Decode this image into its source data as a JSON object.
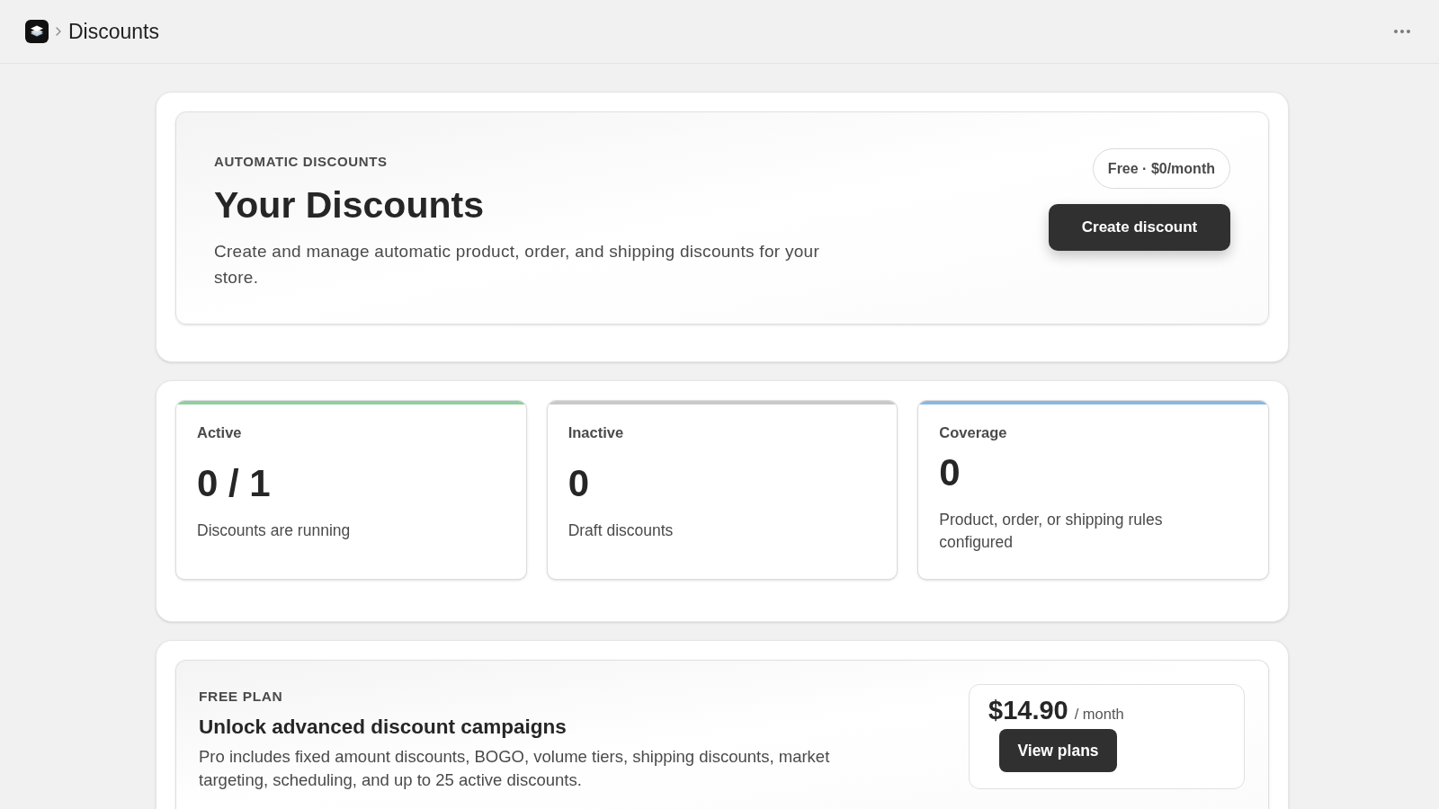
{
  "top_bar": {
    "title": "Discounts"
  },
  "header": {
    "eyebrow": "AUTOMATIC DISCOUNTS",
    "title": "Your Discounts",
    "description": "Create and manage automatic product, order, and shipping discounts for your store.",
    "plan_badge": "Free · $0/month",
    "primary_button": "Create discount"
  },
  "stats": [
    {
      "label": "Active",
      "value": "0 / 1",
      "caption": "Discounts are running",
      "color": "#8fcf9f"
    },
    {
      "label": "Inactive",
      "value": "0",
      "caption": "Draft discounts",
      "color": "#c9c9c9"
    },
    {
      "label": "Coverage",
      "value": "0",
      "caption": "Product, order, or shipping rules configured",
      "color": "#8bb8e0"
    }
  ],
  "upgrade": {
    "eyebrow": "FREE PLAN",
    "title": "Unlock advanced discount campaigns",
    "description": "Pro includes fixed amount discounts, BOGO, volume tiers, shipping discounts, market targeting, scheduling, and up to 25 active discounts.",
    "price": "$14.90",
    "period": "/ month",
    "button": "View plans"
  }
}
